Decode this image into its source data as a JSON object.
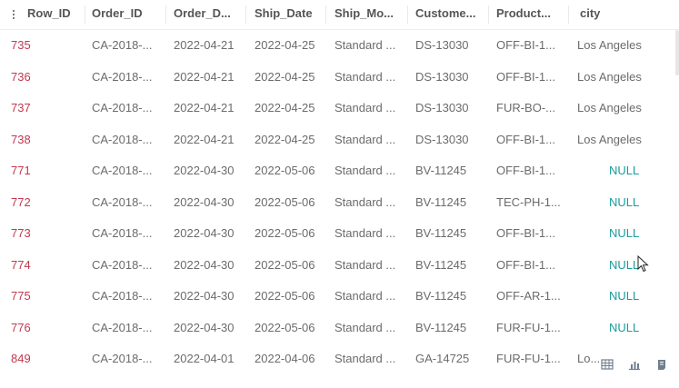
{
  "columns": [
    {
      "key": "row_id",
      "label": "Row_ID"
    },
    {
      "key": "order_id",
      "label": "Order_ID"
    },
    {
      "key": "order_date",
      "label": "Order_D..."
    },
    {
      "key": "ship_date",
      "label": "Ship_Date"
    },
    {
      "key": "ship_mode",
      "label": "Ship_Mo..."
    },
    {
      "key": "customer",
      "label": "Custome..."
    },
    {
      "key": "product",
      "label": "Product..."
    },
    {
      "key": "city",
      "label": "city"
    }
  ],
  "rows": [
    {
      "row_id": "735",
      "order_id": "CA-2018-...",
      "order_date": "2022-04-21",
      "ship_date": "2022-04-25",
      "ship_mode": "Standard ...",
      "customer": "DS-13030",
      "product": "OFF-BI-1...",
      "city": "Los Angeles"
    },
    {
      "row_id": "736",
      "order_id": "CA-2018-...",
      "order_date": "2022-04-21",
      "ship_date": "2022-04-25",
      "ship_mode": "Standard ...",
      "customer": "DS-13030",
      "product": "OFF-BI-1...",
      "city": "Los Angeles"
    },
    {
      "row_id": "737",
      "order_id": "CA-2018-...",
      "order_date": "2022-04-21",
      "ship_date": "2022-04-25",
      "ship_mode": "Standard ...",
      "customer": "DS-13030",
      "product": "FUR-BO-...",
      "city": "Los Angeles"
    },
    {
      "row_id": "738",
      "order_id": "CA-2018-...",
      "order_date": "2022-04-21",
      "ship_date": "2022-04-25",
      "ship_mode": "Standard ...",
      "customer": "DS-13030",
      "product": "OFF-BI-1...",
      "city": "Los Angeles"
    },
    {
      "row_id": "771",
      "order_id": "CA-2018-...",
      "order_date": "2022-04-30",
      "ship_date": "2022-05-06",
      "ship_mode": "Standard ...",
      "customer": "BV-11245",
      "product": "OFF-BI-1...",
      "city": "NULL"
    },
    {
      "row_id": "772",
      "order_id": "CA-2018-...",
      "order_date": "2022-04-30",
      "ship_date": "2022-05-06",
      "ship_mode": "Standard ...",
      "customer": "BV-11245",
      "product": "TEC-PH-1...",
      "city": "NULL"
    },
    {
      "row_id": "773",
      "order_id": "CA-2018-...",
      "order_date": "2022-04-30",
      "ship_date": "2022-05-06",
      "ship_mode": "Standard ...",
      "customer": "BV-11245",
      "product": "OFF-BI-1...",
      "city": "NULL"
    },
    {
      "row_id": "774",
      "order_id": "CA-2018-...",
      "order_date": "2022-04-30",
      "ship_date": "2022-05-06",
      "ship_mode": "Standard ...",
      "customer": "BV-11245",
      "product": "OFF-BI-1...",
      "city": "NULL"
    },
    {
      "row_id": "775",
      "order_id": "CA-2018-...",
      "order_date": "2022-04-30",
      "ship_date": "2022-05-06",
      "ship_mode": "Standard ...",
      "customer": "BV-11245",
      "product": "OFF-AR-1...",
      "city": "NULL"
    },
    {
      "row_id": "776",
      "order_id": "CA-2018-...",
      "order_date": "2022-04-30",
      "ship_date": "2022-05-06",
      "ship_mode": "Standard ...",
      "customer": "BV-11245",
      "product": "FUR-FU-1...",
      "city": "NULL"
    },
    {
      "row_id": "849",
      "order_id": "CA-2018-...",
      "order_date": "2022-04-01",
      "ship_date": "2022-04-06",
      "ship_mode": "Standard ...",
      "customer": "GA-14725",
      "product": "FUR-FU-1...",
      "city": "Lo..."
    }
  ],
  "footer": {
    "icons": [
      "table-view-icon",
      "chart-view-icon",
      "export-icon"
    ]
  },
  "colors": {
    "row_id": "#c0394f",
    "null": "#1a9b9b",
    "text": "#6b6b6b",
    "header": "#555555"
  }
}
